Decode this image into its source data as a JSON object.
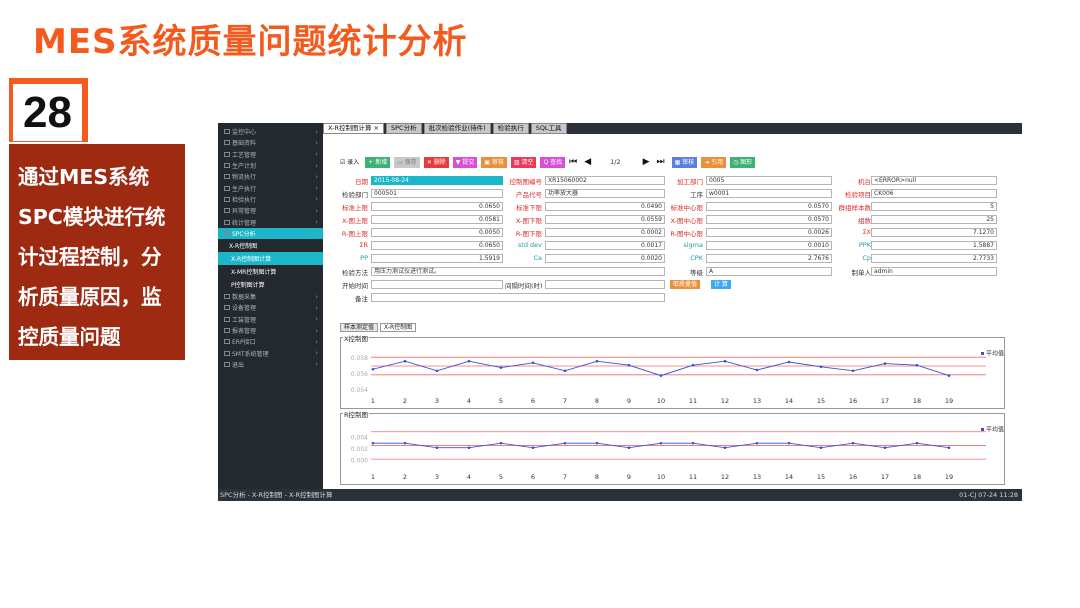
{
  "slide": {
    "title": "MES系统质量问题统计分析",
    "number": "28",
    "description_lines": [
      "通过MES系统",
      "SPC模块进行统",
      "计过程控制，分",
      "析质量原因，监",
      "控质量问题"
    ]
  },
  "sidebar": {
    "items": [
      {
        "label": "监控中心"
      },
      {
        "label": "基础资料"
      },
      {
        "label": "工艺管理"
      },
      {
        "label": "生产计划"
      },
      {
        "label": "物流执行"
      },
      {
        "label": "生产执行"
      },
      {
        "label": "检验执行"
      },
      {
        "label": "异常管理"
      },
      {
        "label": "统计管理"
      },
      {
        "label": "SPC分析",
        "active": true
      }
    ],
    "sub_header": "X-R控制图",
    "sub_items": [
      {
        "label": "X-R控制图计算",
        "selected": true
      },
      {
        "label": "X-MR控制图计算"
      },
      {
        "label": "P控制图计算"
      }
    ],
    "items_after": [
      {
        "label": "数据采集"
      },
      {
        "label": "设备管理"
      },
      {
        "label": "工装管理"
      },
      {
        "label": "报表管理"
      },
      {
        "label": "ERP接口"
      },
      {
        "label": "SMT系统管理"
      },
      {
        "label": "退出"
      }
    ]
  },
  "tabs": [
    {
      "label": "X-R控制图计算 ×",
      "active": true
    },
    {
      "label": "SPC分析"
    },
    {
      "label": "批次检验作业(待件)"
    },
    {
      "label": "检验执行"
    },
    {
      "label": "SQL工具"
    }
  ],
  "toolbar": {
    "checkbox_label": "☑ 录入",
    "buttons": [
      {
        "label": "+ 新增",
        "color": "#3cb371"
      },
      {
        "label": "▭ 保存",
        "color": "#c8c8c8"
      },
      {
        "label": "✕ 删除",
        "color": "#e83a3a"
      },
      {
        "label": "▼ 提交",
        "color": "#d64fd6"
      },
      {
        "label": "▣ 审核",
        "color": "#e8903a"
      },
      {
        "label": "▥ 清空",
        "color": "#e83a5a"
      },
      {
        "label": "Q 查找",
        "color": "#d64fd6"
      }
    ],
    "page_info": "1/2",
    "right_buttons": [
      {
        "label": "▦ 审核",
        "color": "#5a7fe0"
      },
      {
        "label": "⇥ 引用",
        "color": "#e8903a"
      },
      {
        "label": "◷ 图形",
        "color": "#3cb371"
      }
    ]
  },
  "form": {
    "date": {
      "label": "日期",
      "value": "2015-08-24"
    },
    "control_no": {
      "label": "控制图编号",
      "value": "XR15060002"
    },
    "process_dept": {
      "label": "加工部门",
      "value": "0005"
    },
    "machine": {
      "label": "机台",
      "value": "<ERROR>null"
    },
    "inspect_dept": {
      "label": "检验部门",
      "value": "000501"
    },
    "product_code": {
      "label": "产品代号",
      "value": "功率放大器"
    },
    "procedure": {
      "label": "工序",
      "value": "w0001"
    },
    "inspect_item": {
      "label": "检验项目",
      "value": "CK006"
    },
    "std_upper": {
      "label": "标准上限",
      "value": "0.0650"
    },
    "std_lower": {
      "label": "标准下限",
      "value": "0.0490"
    },
    "std_center": {
      "label": "标准中心限",
      "value": "0.0570"
    },
    "group_size": {
      "label": "群组样本数",
      "value": "5"
    },
    "x_upper": {
      "label": "X-图上限",
      "value": "0.0581"
    },
    "x_lower": {
      "label": "X-图下限",
      "value": "0.0559"
    },
    "x_center": {
      "label": "X-图中心限",
      "value": "0.0570"
    },
    "groups": {
      "label": "组数",
      "value": "25"
    },
    "r_upper": {
      "label": "R-图上限",
      "value": "0.0050"
    },
    "r_lower": {
      "label": "R-图下限",
      "value": "0.0002"
    },
    "r_center": {
      "label": "R-图中心限",
      "value": "0.0026"
    },
    "sum_x": {
      "label": "ΣX",
      "value": "7.1270"
    },
    "sum_r": {
      "label": "ΣR",
      "value": "0.0650"
    },
    "std_dev": {
      "label": "std dev",
      "value": "0.0017"
    },
    "sigma": {
      "label": "sigma",
      "value": "0.0010"
    },
    "ppk": {
      "label": "PPK",
      "value": "1.5887"
    },
    "pp": {
      "label": "PP",
      "value": "1.5919"
    },
    "ca": {
      "label": "Ca",
      "value": "0.0020"
    },
    "cpk": {
      "label": "CPK",
      "value": "2.7676"
    },
    "cp": {
      "label": "Cp",
      "value": "2.7733"
    },
    "method": {
      "label": "检验方法",
      "value": "用压力测试仪进行测试。"
    },
    "grade": {
      "label": "等级",
      "value": "A"
    },
    "creator": {
      "label": "制单人",
      "value": "admin"
    },
    "start_time": {
      "label": "开始时间",
      "value": ""
    },
    "interval": {
      "label": "间隔时间(时)",
      "value": ""
    },
    "btn_quality": {
      "label": "取质量值",
      "color": "#e8903a"
    },
    "btn_calc": {
      "label": "计 算",
      "color": "#3fa9f5"
    },
    "remark": {
      "label": "备注",
      "value": ""
    }
  },
  "subtabs": [
    {
      "label": "样本测定值"
    },
    {
      "label": "X-R控制图",
      "active": true
    }
  ],
  "chart_data": [
    {
      "type": "line",
      "title": "X控制图",
      "x": [
        1,
        2,
        3,
        4,
        5,
        6,
        7,
        8,
        9,
        10,
        11,
        12,
        13,
        14,
        15,
        16,
        17,
        18,
        19
      ],
      "series": [
        {
          "name": "平均值",
          "values": [
            0.0566,
            0.0576,
            0.0564,
            0.0576,
            0.0568,
            0.0574,
            0.0564,
            0.0576,
            0.0571,
            0.0558,
            0.0571,
            0.0576,
            0.0565,
            0.0575,
            0.0569,
            0.0564,
            0.0573,
            0.0571,
            0.0558
          ]
        }
      ],
      "ytick_labels": [
        "0.058",
        "0.056",
        "0.054"
      ],
      "ylim": [
        0.054,
        0.059
      ],
      "control_lines": [
        0.0581,
        0.057,
        0.0559
      ],
      "legend": "top-right",
      "color": "#3d4fd8"
    },
    {
      "type": "line",
      "title": "R控制图",
      "x": [
        1,
        2,
        3,
        4,
        5,
        6,
        7,
        8,
        9,
        10,
        11,
        12,
        13,
        14,
        15,
        16,
        17,
        18,
        19
      ],
      "series": [
        {
          "name": "平均值",
          "values": [
            0.003,
            0.003,
            0.0022,
            0.0022,
            0.003,
            0.0022,
            0.003,
            0.003,
            0.0022,
            0.003,
            0.003,
            0.0022,
            0.003,
            0.003,
            0.0022,
            0.003,
            0.0022,
            0.003,
            0.0022
          ]
        }
      ],
      "ytick_labels": [
        "0.004",
        "0.002",
        "0.000"
      ],
      "ylim": [
        -0.001,
        0.006
      ],
      "control_lines": [
        0.005,
        0.0026,
        0.0002
      ],
      "legend": "top-right",
      "color": "#3d4fd8"
    }
  ],
  "statusbar": {
    "left": "SPC分析 - X-R控制图 - X-R控制图计算",
    "right": "01-CJ 07-24 11:28"
  }
}
